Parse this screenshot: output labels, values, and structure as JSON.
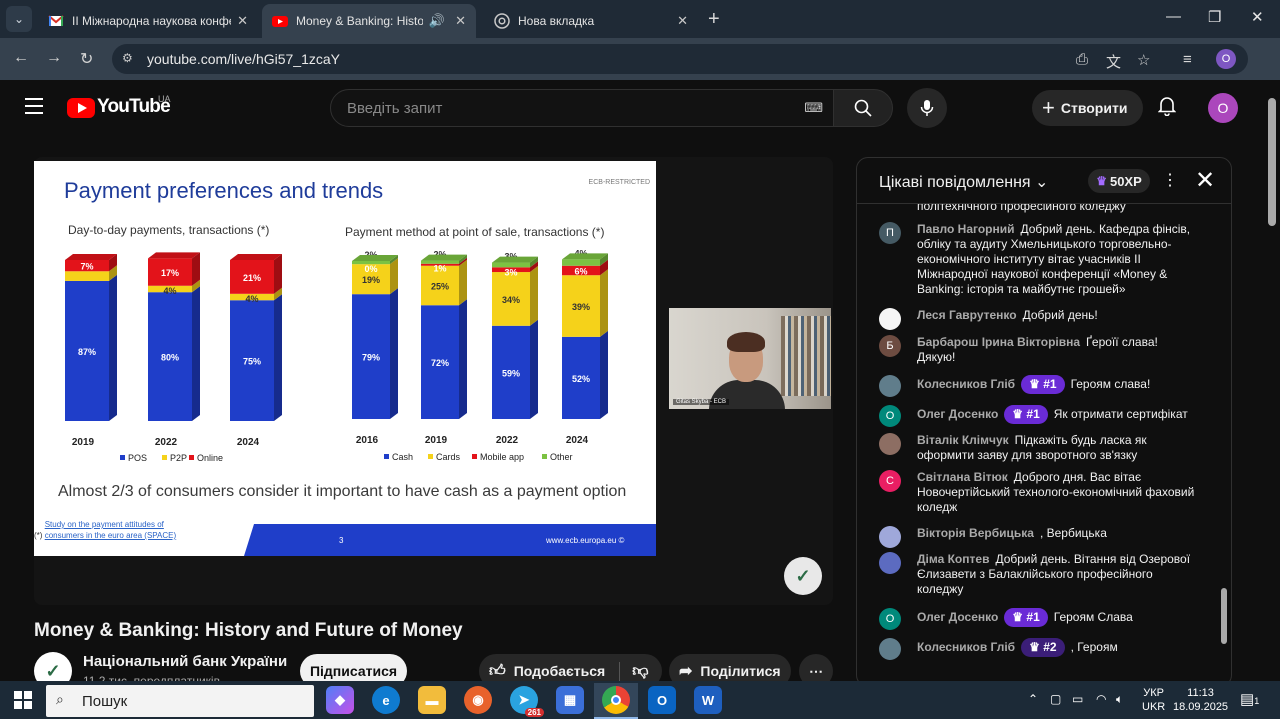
{
  "browser": {
    "tabs": [
      {
        "title": "II Міжнародна наукова конфе",
        "icon": "gmail-icon"
      },
      {
        "title": "Money & Banking: History a",
        "icon": "youtube-icon"
      },
      {
        "title": "Нова вкладка",
        "icon": "chrome-icon"
      }
    ],
    "url": "youtube.com/live/hGi57_1zcaY",
    "profile_letter": "O"
  },
  "header": {
    "logo_text": "YouTube",
    "region": "UA",
    "search_placeholder": "Введіть запит",
    "create_label": "Створити",
    "avatar_letter": "O"
  },
  "slide": {
    "title": "Payment preferences and trends",
    "restricted": "ECB-RESTRICTED",
    "left_subtitle": "Day-to-day payments, transactions (*)",
    "right_subtitle": "Payment method at point of sale, transactions (*)",
    "caption": "Almost 2/3 of consumers consider it important to have cash as a payment option",
    "footnote_prefix": "(*)",
    "footnote_link": "Study on the payment attitudes of consumers in the euro area (SPACE)",
    "page_number": "3",
    "site": "www.ecb.europa.eu ©",
    "presenter_tag": "Gitas Skyba - ECB"
  },
  "chart_data": [
    {
      "type": "bar",
      "stacked": true,
      "categories": [
        "2019",
        "2022",
        "2024"
      ],
      "series": [
        {
          "name": "POS",
          "values": [
            87,
            80,
            75
          ],
          "color": "#1f3ec9"
        },
        {
          "name": "P2P",
          "values": [
            6,
            4,
            4
          ],
          "color": "#f5d21a"
        },
        {
          "name": "Online",
          "values": [
            7,
            17,
            21
          ],
          "color": "#e3131a"
        }
      ],
      "data_labels": [
        [
          "87%",
          "",
          "7%"
        ],
        [
          "80%",
          "4%",
          "17%"
        ],
        [
          "75%",
          "4%",
          "21%"
        ]
      ],
      "ylim": [
        0,
        100
      ]
    },
    {
      "type": "bar",
      "stacked": true,
      "categories": [
        "2016",
        "2019",
        "2022",
        "2024"
      ],
      "series": [
        {
          "name": "Cash",
          "values": [
            79,
            72,
            59,
            52
          ],
          "color": "#1f3ec9"
        },
        {
          "name": "Cards",
          "values": [
            19,
            25,
            34,
            39
          ],
          "color": "#f5d21a"
        },
        {
          "name": "Mobile app",
          "values": [
            0,
            1,
            3,
            6
          ],
          "color": "#e3131a"
        },
        {
          "name": "Other",
          "values": [
            2,
            2,
            3,
            4
          ],
          "color": "#7cc242"
        }
      ],
      "data_labels": [
        [
          "79%",
          "19%",
          "0%",
          "2%"
        ],
        [
          "72%",
          "25%",
          "1%",
          "2%"
        ],
        [
          "59%",
          "34%",
          "3%",
          "3%"
        ],
        [
          "52%",
          "39%",
          "6%",
          "4%"
        ]
      ],
      "ylim": [
        0,
        100
      ]
    }
  ],
  "video": {
    "title": "Money & Banking: History and Future of Money",
    "channel": "Національний банк України",
    "subscribers": "11,2 тис. передплатників",
    "subscribe_label": "Підписатися",
    "like_label": "Подобається",
    "share_label": "Поділитися"
  },
  "chat": {
    "title": "Цікаві повідомлення",
    "xp": "50XP",
    "top_fragment": "політехнічного професійного коледжу",
    "messages": [
      {
        "author": "Павло Нагорний",
        "text": "Добрий день. Кафедра фінсів, обліку та аудиту Хмельницького торговельно-економічного інституту вітає учасників ІІ Міжнародної наукової конференції «Money & Banking: історія та майбутнє грошей»",
        "avatar": "П",
        "color": "#455a64",
        "badge": ""
      },
      {
        "author": "Леся Гаврутенко",
        "text": "Добрий день!",
        "avatar": "",
        "color": "#f5f5f5",
        "badge": ""
      },
      {
        "author": "Барбарош Ірина Вікторівна",
        "text": "Ґероїї слава! Дякую!",
        "avatar": "Б",
        "color": "#6d4c41",
        "badge": ""
      },
      {
        "author": "Колесников Гліб",
        "text": "Героям слава!",
        "avatar": "",
        "color": "#607d8b",
        "badge": "#1"
      },
      {
        "author": "Олег Досенко",
        "text": "Як отримати сертифікат",
        "avatar": "O",
        "color": "#00897b",
        "badge": "#1"
      },
      {
        "author": "Віталік Клімчук",
        "text": "Підкажіть будь ласка як оформити заяву для зворотного зв'язку",
        "avatar": "",
        "color": "#8d6e63",
        "badge": ""
      },
      {
        "author": "Світлана Вітюк",
        "text": "Доброго дня. Вас вітає Новочертійський технолого-економічний фаховий коледж",
        "avatar": "С",
        "color": "#e91e63",
        "badge": ""
      },
      {
        "author": "Вікторія Вербицька",
        "text": ", Вербицька",
        "avatar": "",
        "color": "#9fa8da",
        "badge": ""
      },
      {
        "author": "Діма Коптев",
        "text": "Добрий день. Вітання від Озерової Єлизавети з Балаклійського професійного коледжу",
        "avatar": "",
        "color": "#5c6bc0",
        "badge": ""
      },
      {
        "author": "Олег Досенко",
        "text": "Героям Слава",
        "avatar": "O",
        "color": "#00897b",
        "badge": "#1"
      },
      {
        "author": "Колесников Гліб",
        "text": ", Героям",
        "avatar": "",
        "color": "#607d8b",
        "badge": "#2"
      }
    ]
  },
  "taskbar": {
    "search_label": "Пошук",
    "telegram_count": "261",
    "lang_top": "УКР",
    "lang_bottom": "UKR",
    "time": "11:13",
    "date": "18.09.2025",
    "notifications": "1"
  }
}
